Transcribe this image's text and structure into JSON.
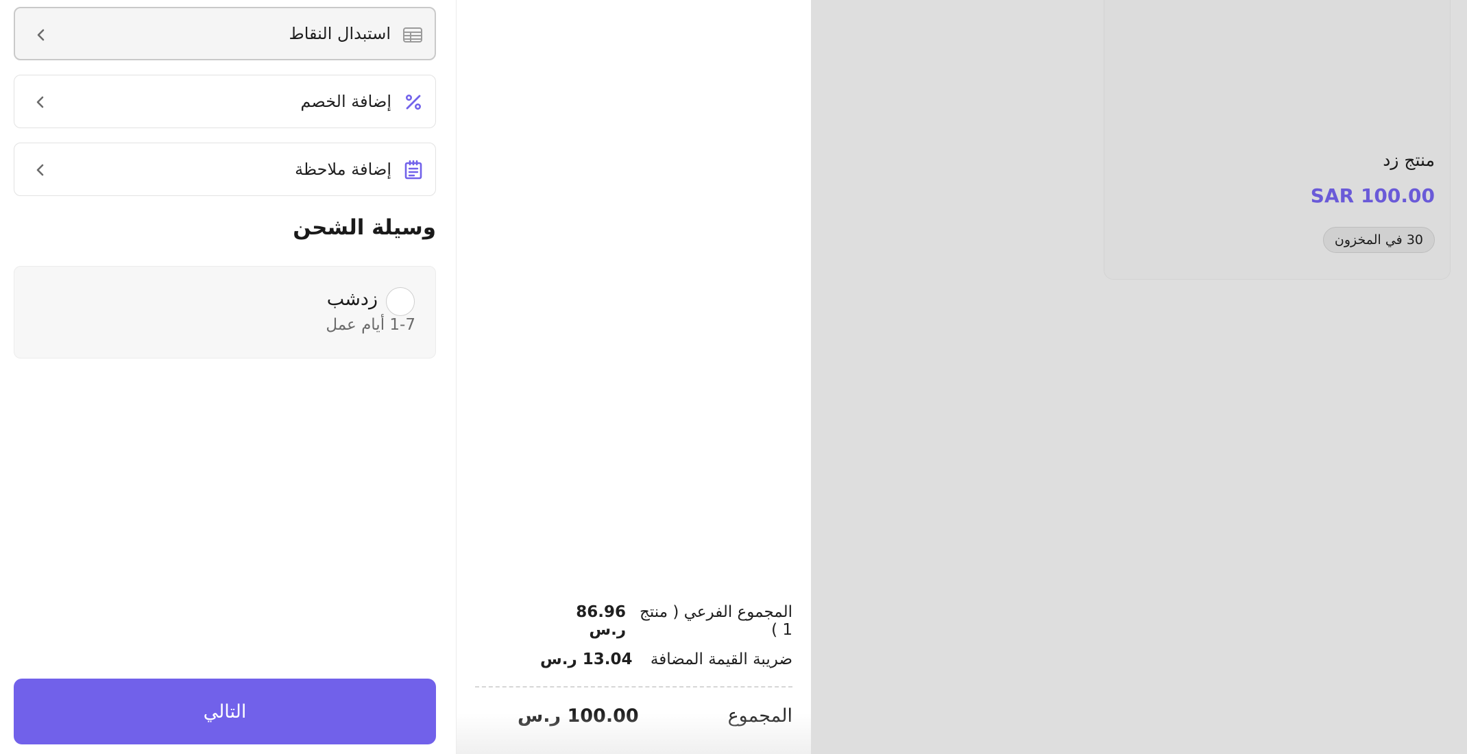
{
  "options": [
    {
      "label": "استبدال النقاط",
      "icon": "points-table-icon"
    },
    {
      "label": "إضافة الخصم",
      "icon": "percent-icon"
    },
    {
      "label": "إضافة ملاحظة",
      "icon": "note-icon"
    }
  ],
  "shipping": {
    "title": "وسيلة الشحن",
    "method_name": "زدشب",
    "method_time": "1-7 أيام عمل"
  },
  "next_button_label": "التالي",
  "summary": {
    "subtotal_label": "المجموع الفرعي ( منتج 1 )",
    "subtotal_value": "86.96 ر.س",
    "vat_label": "ضريبة القيمة المضافة",
    "vat_value": "13.04 ر.س",
    "total_label": "المجموع",
    "total_value": "100.00 ر.س"
  },
  "product": {
    "name": "منتج زد",
    "price": "SAR 100.00",
    "stock": "30 في المخزون"
  },
  "colors": {
    "accent": "#7161ea",
    "price": "#6a5ad8",
    "panel_bg": "#dedede"
  }
}
